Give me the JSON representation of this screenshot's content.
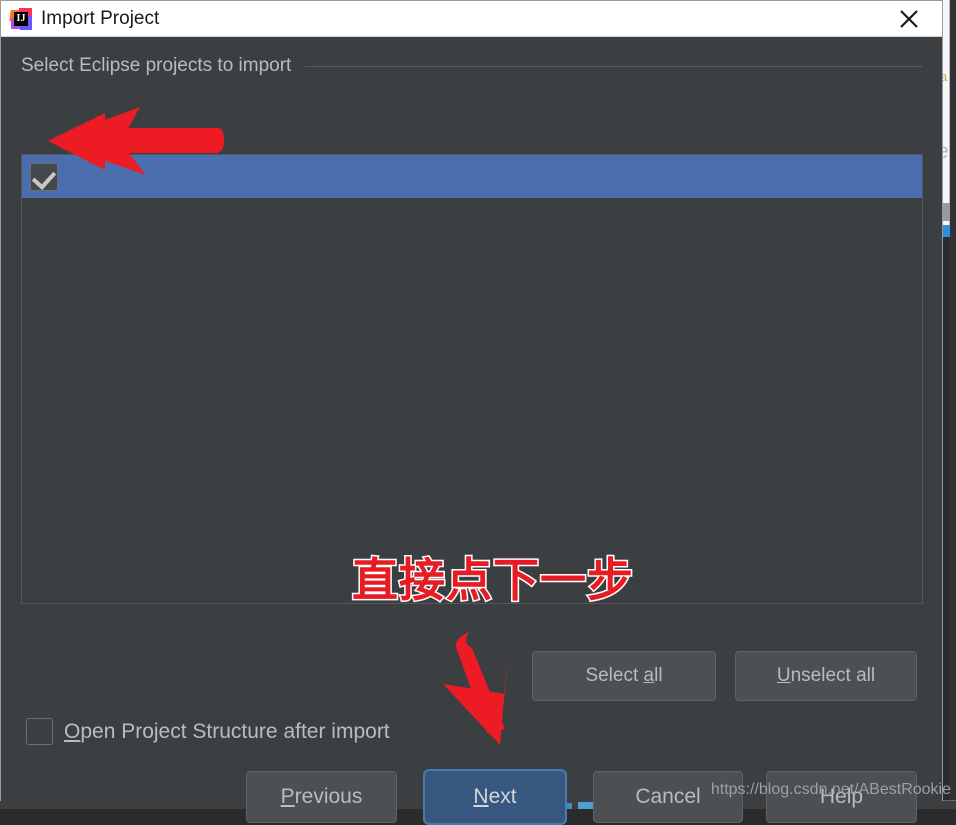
{
  "window": {
    "title": "Import Project",
    "app_icon": "intellij-idea-logo",
    "close_icon": "close-icon"
  },
  "section": {
    "header": "Select Eclipse projects to import"
  },
  "project_list": {
    "rows": [
      {
        "label": "",
        "checked": true,
        "selected": true
      }
    ]
  },
  "list_buttons": {
    "select_all": "Select all",
    "select_all_mnemonic": "a",
    "unselect_all": "Unselect all",
    "unselect_all_mnemonic": "U"
  },
  "options": {
    "open_project_structure": {
      "label": "Open Project Structure after import",
      "mnemonic": "O",
      "checked": false
    }
  },
  "footer_buttons": {
    "previous": "Previous",
    "previous_mnemonic": "P",
    "next": "Next",
    "next_mnemonic": "N",
    "cancel": "Cancel",
    "help": "Help"
  },
  "annotations": {
    "chinese_note": "直接点下一步",
    "arrow_color": "#ed1c24",
    "arrow_to_checkbox": "red-arrow-left-icon",
    "arrow_to_next": "red-arrow-down-icon"
  },
  "watermark": {
    "url": "https://blog.csdn.net/ABestRookie"
  },
  "colors": {
    "dialog_bg": "#3c3f41",
    "titlebar_bg": "#ffffff",
    "selection_blue": "#4b6eaf",
    "default_button_blue": "#365880",
    "text": "#bbbbbb",
    "annotation_red": "#e61c24"
  }
}
